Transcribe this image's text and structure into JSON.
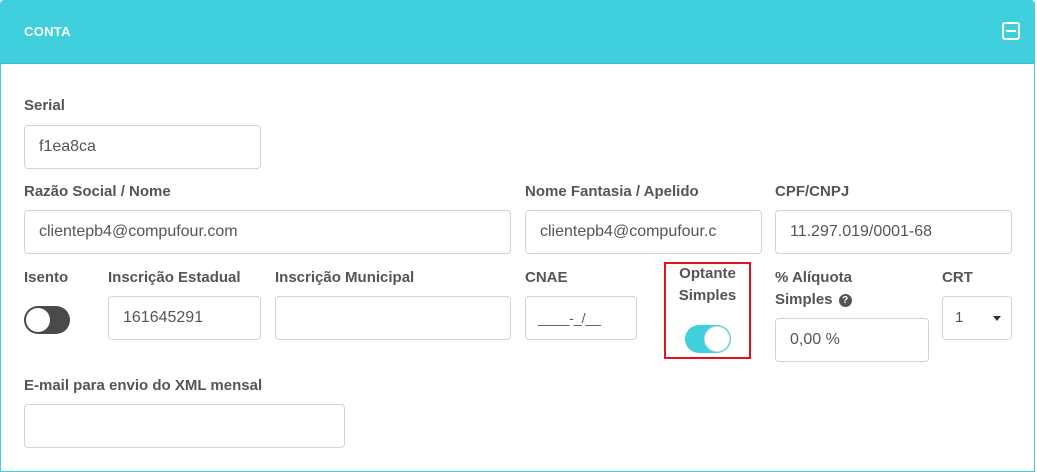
{
  "panel": {
    "title": "CONTA"
  },
  "fields": {
    "serial": {
      "label": "Serial",
      "value": "f1ea8ca"
    },
    "razao_social": {
      "label": "Razão Social / Nome",
      "value": "clientepb4@compufour.com"
    },
    "nome_fantasia": {
      "label": "Nome Fantasia / Apelido",
      "value": "clientepb4@compufour.c"
    },
    "cpf_cnpj": {
      "label": "CPF/CNPJ",
      "value": "11.297.019/0001-68"
    },
    "isento": {
      "label": "Isento",
      "checked": false
    },
    "inscricao_estadual": {
      "label": "Inscrição Estadual",
      "value": "161645291"
    },
    "inscricao_municipal": {
      "label": "Inscrição Municipal",
      "value": ""
    },
    "cnae": {
      "label": "CNAE",
      "value": "____-_/__"
    },
    "optante_simples": {
      "label_line1": "Optante",
      "label_line2": "Simples",
      "checked": true
    },
    "aliquota_simples": {
      "label_line1": "% Alíquota",
      "label_line2": "Simples",
      "help_icon": "question-circle-icon",
      "value": "0,00 %"
    },
    "crt": {
      "label": "CRT",
      "value": "1"
    },
    "email_xml": {
      "label": "E-mail para envio do XML mensal",
      "value": ""
    }
  },
  "colors": {
    "accent": "#40cfdc",
    "highlight": "#e0131e",
    "toggle_off": "#4a4a4a"
  }
}
